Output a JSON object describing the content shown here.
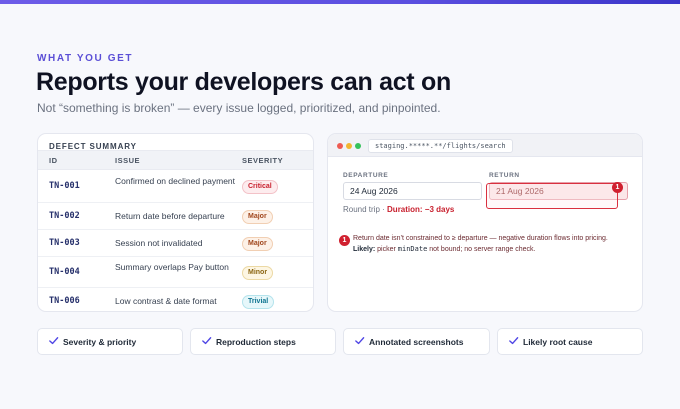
{
  "hero": {
    "eyebrow": "WHAT YOU GET",
    "headline": "Reports your developers can act on",
    "subtitle": "Not “something is broken” — every issue logged, prioritized, and pinpointed."
  },
  "defects": {
    "title": "DEFECT SUMMARY",
    "columns": {
      "id": "ID",
      "issue": "ISSUE",
      "severity": "SEVERITY"
    },
    "rows": [
      {
        "id": "TN-001",
        "issue": "Confirmed on declined payment",
        "severity": "Critical"
      },
      {
        "id": "TN-002",
        "issue": "Return date before departure",
        "severity": "Major"
      },
      {
        "id": "TN-003",
        "issue": "Session not invalidated",
        "severity": "Major"
      },
      {
        "id": "TN-004",
        "issue": "Summary overlaps Pay button",
        "severity": "Minor"
      },
      {
        "id": "TN-006",
        "issue": "Low contrast & date format",
        "severity": "Trivial"
      }
    ]
  },
  "browser": {
    "url": "staging.*****.**/flights/search",
    "departure_label": "DEPARTURE",
    "departure_value": "24 Aug 2026",
    "return_label": "RETURN",
    "return_value": "21 Aug 2026",
    "marker": "1",
    "round_trip": "Round trip ·",
    "duration": "Duration: −3 days",
    "note": {
      "marker": "1",
      "line1": "Return date isn’t constrained to ≥ departure — negative duration flows into pricing.",
      "likely_label": "Likely:",
      "likely_pre": "picker",
      "likely_code": "minDate",
      "likely_post": "not bound; no server range check."
    }
  },
  "features": [
    {
      "label": "Severity & priority"
    },
    {
      "label": "Reproduction steps"
    },
    {
      "label": "Annotated screenshots"
    },
    {
      "label": "Likely root cause"
    }
  ],
  "colors": {
    "accent": "#5b4fd6",
    "critical": "#c8202e",
    "major": "#a0461c",
    "minor": "#8a6410",
    "trivial": "#0e7490"
  }
}
